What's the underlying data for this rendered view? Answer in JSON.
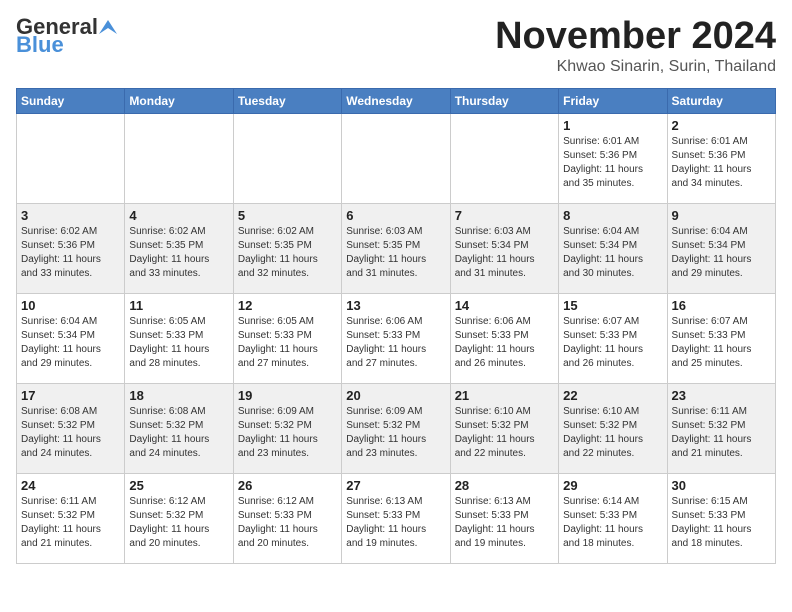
{
  "header": {
    "logo_general": "General",
    "logo_blue": "Blue",
    "month": "November 2024",
    "location": "Khwao Sinarin, Surin, Thailand"
  },
  "days_of_week": [
    "Sunday",
    "Monday",
    "Tuesday",
    "Wednesday",
    "Thursday",
    "Friday",
    "Saturday"
  ],
  "weeks": [
    [
      {
        "day": "",
        "info": ""
      },
      {
        "day": "",
        "info": ""
      },
      {
        "day": "",
        "info": ""
      },
      {
        "day": "",
        "info": ""
      },
      {
        "day": "",
        "info": ""
      },
      {
        "day": "1",
        "info": "Sunrise: 6:01 AM\nSunset: 5:36 PM\nDaylight: 11 hours\nand 35 minutes."
      },
      {
        "day": "2",
        "info": "Sunrise: 6:01 AM\nSunset: 5:36 PM\nDaylight: 11 hours\nand 34 minutes."
      }
    ],
    [
      {
        "day": "3",
        "info": "Sunrise: 6:02 AM\nSunset: 5:36 PM\nDaylight: 11 hours\nand 33 minutes."
      },
      {
        "day": "4",
        "info": "Sunrise: 6:02 AM\nSunset: 5:35 PM\nDaylight: 11 hours\nand 33 minutes."
      },
      {
        "day": "5",
        "info": "Sunrise: 6:02 AM\nSunset: 5:35 PM\nDaylight: 11 hours\nand 32 minutes."
      },
      {
        "day": "6",
        "info": "Sunrise: 6:03 AM\nSunset: 5:35 PM\nDaylight: 11 hours\nand 31 minutes."
      },
      {
        "day": "7",
        "info": "Sunrise: 6:03 AM\nSunset: 5:34 PM\nDaylight: 11 hours\nand 31 minutes."
      },
      {
        "day": "8",
        "info": "Sunrise: 6:04 AM\nSunset: 5:34 PM\nDaylight: 11 hours\nand 30 minutes."
      },
      {
        "day": "9",
        "info": "Sunrise: 6:04 AM\nSunset: 5:34 PM\nDaylight: 11 hours\nand 29 minutes."
      }
    ],
    [
      {
        "day": "10",
        "info": "Sunrise: 6:04 AM\nSunset: 5:34 PM\nDaylight: 11 hours\nand 29 minutes."
      },
      {
        "day": "11",
        "info": "Sunrise: 6:05 AM\nSunset: 5:33 PM\nDaylight: 11 hours\nand 28 minutes."
      },
      {
        "day": "12",
        "info": "Sunrise: 6:05 AM\nSunset: 5:33 PM\nDaylight: 11 hours\nand 27 minutes."
      },
      {
        "day": "13",
        "info": "Sunrise: 6:06 AM\nSunset: 5:33 PM\nDaylight: 11 hours\nand 27 minutes."
      },
      {
        "day": "14",
        "info": "Sunrise: 6:06 AM\nSunset: 5:33 PM\nDaylight: 11 hours\nand 26 minutes."
      },
      {
        "day": "15",
        "info": "Sunrise: 6:07 AM\nSunset: 5:33 PM\nDaylight: 11 hours\nand 26 minutes."
      },
      {
        "day": "16",
        "info": "Sunrise: 6:07 AM\nSunset: 5:33 PM\nDaylight: 11 hours\nand 25 minutes."
      }
    ],
    [
      {
        "day": "17",
        "info": "Sunrise: 6:08 AM\nSunset: 5:32 PM\nDaylight: 11 hours\nand 24 minutes."
      },
      {
        "day": "18",
        "info": "Sunrise: 6:08 AM\nSunset: 5:32 PM\nDaylight: 11 hours\nand 24 minutes."
      },
      {
        "day": "19",
        "info": "Sunrise: 6:09 AM\nSunset: 5:32 PM\nDaylight: 11 hours\nand 23 minutes."
      },
      {
        "day": "20",
        "info": "Sunrise: 6:09 AM\nSunset: 5:32 PM\nDaylight: 11 hours\nand 23 minutes."
      },
      {
        "day": "21",
        "info": "Sunrise: 6:10 AM\nSunset: 5:32 PM\nDaylight: 11 hours\nand 22 minutes."
      },
      {
        "day": "22",
        "info": "Sunrise: 6:10 AM\nSunset: 5:32 PM\nDaylight: 11 hours\nand 22 minutes."
      },
      {
        "day": "23",
        "info": "Sunrise: 6:11 AM\nSunset: 5:32 PM\nDaylight: 11 hours\nand 21 minutes."
      }
    ],
    [
      {
        "day": "24",
        "info": "Sunrise: 6:11 AM\nSunset: 5:32 PM\nDaylight: 11 hours\nand 21 minutes."
      },
      {
        "day": "25",
        "info": "Sunrise: 6:12 AM\nSunset: 5:32 PM\nDaylight: 11 hours\nand 20 minutes."
      },
      {
        "day": "26",
        "info": "Sunrise: 6:12 AM\nSunset: 5:33 PM\nDaylight: 11 hours\nand 20 minutes."
      },
      {
        "day": "27",
        "info": "Sunrise: 6:13 AM\nSunset: 5:33 PM\nDaylight: 11 hours\nand 19 minutes."
      },
      {
        "day": "28",
        "info": "Sunrise: 6:13 AM\nSunset: 5:33 PM\nDaylight: 11 hours\nand 19 minutes."
      },
      {
        "day": "29",
        "info": "Sunrise: 6:14 AM\nSunset: 5:33 PM\nDaylight: 11 hours\nand 18 minutes."
      },
      {
        "day": "30",
        "info": "Sunrise: 6:15 AM\nSunset: 5:33 PM\nDaylight: 11 hours\nand 18 minutes."
      }
    ]
  ]
}
